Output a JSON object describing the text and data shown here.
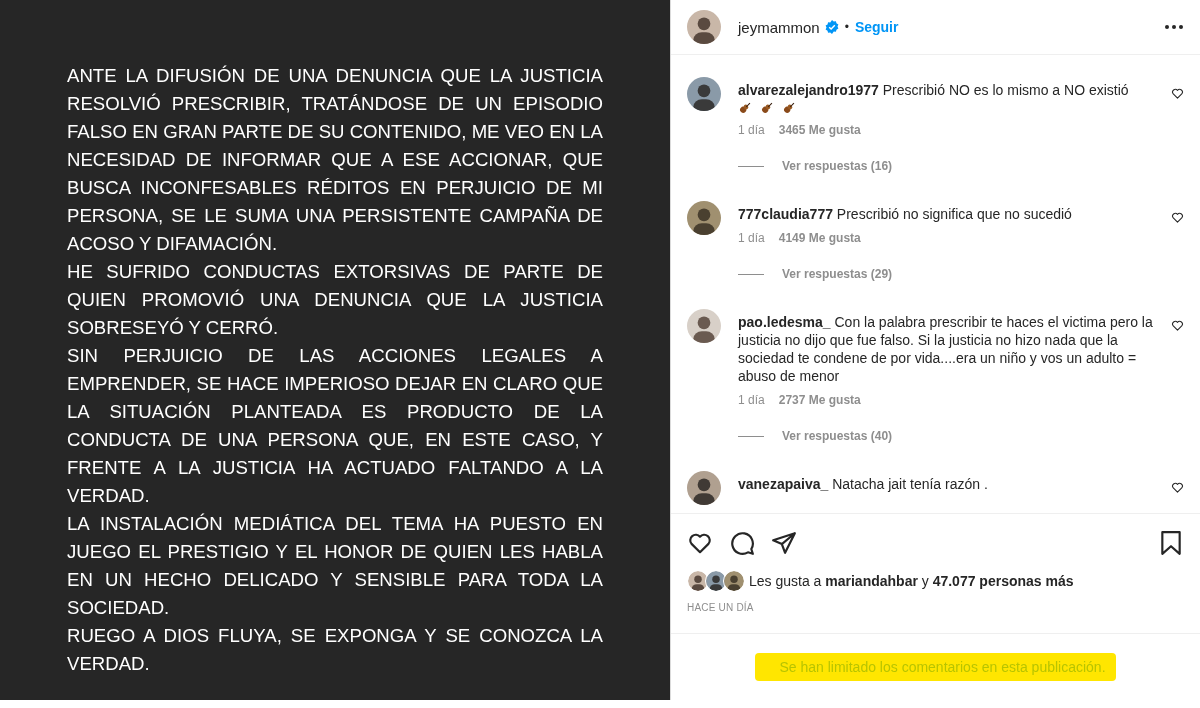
{
  "post_image": {
    "paragraphs": [
      "ANTE LA DIFUSIÓN DE UNA DENUNCIA QUE LA JUSTICIA RESOLVIÓ PRESCRIBIR, TRATÁNDOSE  DE UN EPISODIO FALSO EN GRAN PARTE DE SU CONTENIDO, ME VEO EN LA NECESIDAD DE INFORMAR QUE A ESE ACCIONAR, QUE BUSCA INCONFESABLES RÉDITOS EN PERJUICIO DE MI PERSONA, SE LE SUMA UNA PERSISTENTE CAMPAÑA DE ACOSO Y DIFAMACIÓN.",
      "HE SUFRIDO CONDUCTAS EXTORSIVAS DE PARTE DE QUIEN PROMOVIÓ UNA DENUNCIA QUE LA JUSTICIA SOBRESEYÓ Y CERRÓ.",
      "SIN PERJUICIO DE LAS ACCIONES LEGALES A EMPRENDER, SE HACE IMPERIOSO DEJAR EN CLARO QUE LA SITUACIÓN PLANTEADA ES PRODUCTO DE LA CONDUCTA DE UNA PERSONA QUE, EN ESTE CASO, Y FRENTE A LA JUSTICIA HA ACTUADO FALTANDO A LA VERDAD.",
      "LA INSTALACIÓN MEDIÁTICA DEL TEMA HA PUESTO EN JUEGO EL PRESTIGIO Y EL HONOR DE QUIEN LES HABLA EN UN HECHO DELICADO Y SENSIBLE PARA TODA LA SOCIEDAD.",
      "RUEGO A DIOS FLUYA, SE EXPONGA Y SE CONOZCA LA VERDAD."
    ]
  },
  "header": {
    "username": "jeymammon",
    "verified": true,
    "separator": "•",
    "follow": "Seguir"
  },
  "comments": [
    {
      "username": "alvarezalejandro1977",
      "text": "Prescribió NO es lo mismo a NO existió",
      "violin_line": true,
      "time": "1 día",
      "likes": "3465 Me gusta",
      "replies": "Ver respuestas (16)"
    },
    {
      "username": "777claudia777",
      "text": "Prescribió no significa que no sucedió",
      "violin_line": false,
      "time": "1 día",
      "likes": "4149 Me gusta",
      "replies": "Ver respuestas (29)"
    },
    {
      "username": "pao.ledesma_",
      "text": "Con la palabra prescribir te haces el victima pero la justicia no dijo que fue falso. Si la justicia no hizo nada que la sociedad te condene de por vida....era un niño y vos un adulto = abuso de menor",
      "violin_line": false,
      "time": "1 día",
      "likes": "2737 Me gusta",
      "replies": "Ver respuestas (40)"
    },
    {
      "username": "vanezapaiva_",
      "text": "Natacha jait tenía razón .",
      "violin_line": false
    }
  ],
  "likes": {
    "prefix": "Les gusta a ",
    "user": "mariandahbar",
    "middle": " y ",
    "count": "47.077 personas más"
  },
  "timestamp": "HACE UN DÍA",
  "notice": {
    "text": "Se han limitado los comentarios en esta publicación.",
    "highlighted": true
  }
}
